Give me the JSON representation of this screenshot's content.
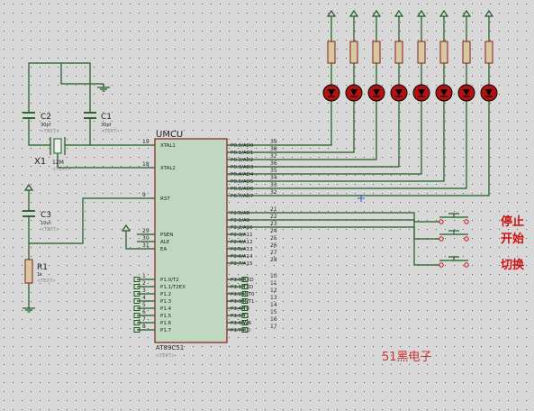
{
  "mcu": {
    "ref": "UMCU",
    "part": "AT89C51",
    "part_text": "<TEXT>",
    "left_pins": [
      {
        "num": "19",
        "name": "XTAL1"
      },
      {
        "num": "18",
        "name": "XTAL2"
      },
      {
        "num": "9",
        "name": "RST"
      },
      {
        "num": "29",
        "name": "PSEN"
      },
      {
        "num": "30",
        "name": "ALE"
      },
      {
        "num": "31",
        "name": "EA"
      },
      {
        "num": "1",
        "name": "P1.0/T2"
      },
      {
        "num": "2",
        "name": "P1.1/T2EX"
      },
      {
        "num": "3",
        "name": "P1.2"
      },
      {
        "num": "4",
        "name": "P1.3"
      },
      {
        "num": "5",
        "name": "P1.4"
      },
      {
        "num": "6",
        "name": "P1.5"
      },
      {
        "num": "7",
        "name": "P1.6"
      },
      {
        "num": "8",
        "name": "P1.7"
      }
    ],
    "right_pins": [
      {
        "num": "39",
        "name": "P0.0/AD0"
      },
      {
        "num": "38",
        "name": "P0.1/AD1"
      },
      {
        "num": "37",
        "name": "P0.2/AD2"
      },
      {
        "num": "36",
        "name": "P0.3/AD3"
      },
      {
        "num": "35",
        "name": "P0.4/AD4"
      },
      {
        "num": "34",
        "name": "P0.5/AD5"
      },
      {
        "num": "33",
        "name": "P0.6/AD6"
      },
      {
        "num": "32",
        "name": "P0.7/AD7"
      },
      {
        "num": "21",
        "name": "P2.0/A8"
      },
      {
        "num": "22",
        "name": "P2.1/A9"
      },
      {
        "num": "23",
        "name": "P2.2/A10"
      },
      {
        "num": "24",
        "name": "P2.3/A11"
      },
      {
        "num": "25",
        "name": "P2.4/A12"
      },
      {
        "num": "26",
        "name": "P2.5/A13"
      },
      {
        "num": "27",
        "name": "P2.6/A14"
      },
      {
        "num": "28",
        "name": "P2.7/A15"
      },
      {
        "num": "10",
        "name": "P3.0/RXD"
      },
      {
        "num": "11",
        "name": "P3.1/TXD"
      },
      {
        "num": "12",
        "name": "P3.2/INT0"
      },
      {
        "num": "13",
        "name": "P3.3/INT1"
      },
      {
        "num": "14",
        "name": "P3.4/T0"
      },
      {
        "num": "15",
        "name": "P3.5/T1"
      },
      {
        "num": "16",
        "name": "P3.6/WR"
      },
      {
        "num": "17",
        "name": "P3.7/RD"
      }
    ]
  },
  "components": {
    "c2": {
      "ref": "C2",
      "value": "30pf",
      "text": "<TEXT>"
    },
    "c1": {
      "ref": "C1",
      "value": "30pf",
      "text": "<TEXT>"
    },
    "x1": {
      "ref": "X1",
      "value": "12M",
      "text": "<TEXT>"
    },
    "c3": {
      "ref": "C3",
      "value": "10uf",
      "text": "<TEXT>"
    },
    "r1": {
      "ref": "R1",
      "value": "1k",
      "text": "<TEXT>"
    }
  },
  "buttons": [
    {
      "label": "停止"
    },
    {
      "label": "开始"
    },
    {
      "label": "切换"
    }
  ],
  "led_count": 8,
  "watermark": "51黑电子",
  "colors": {
    "background": "#d8d8d8",
    "grid_dot": "#555555",
    "wire": "#1a5e1a",
    "body_fill": "#c0d7c0",
    "body_stroke": "#8b1a1a",
    "label_text": "#222222",
    "pin_num": "#2a2a2a",
    "resistor_fill": "#d9c9a3",
    "led_fill": "#b21212",
    "button_label": "#cc1111",
    "watermark": "#cc3333"
  }
}
